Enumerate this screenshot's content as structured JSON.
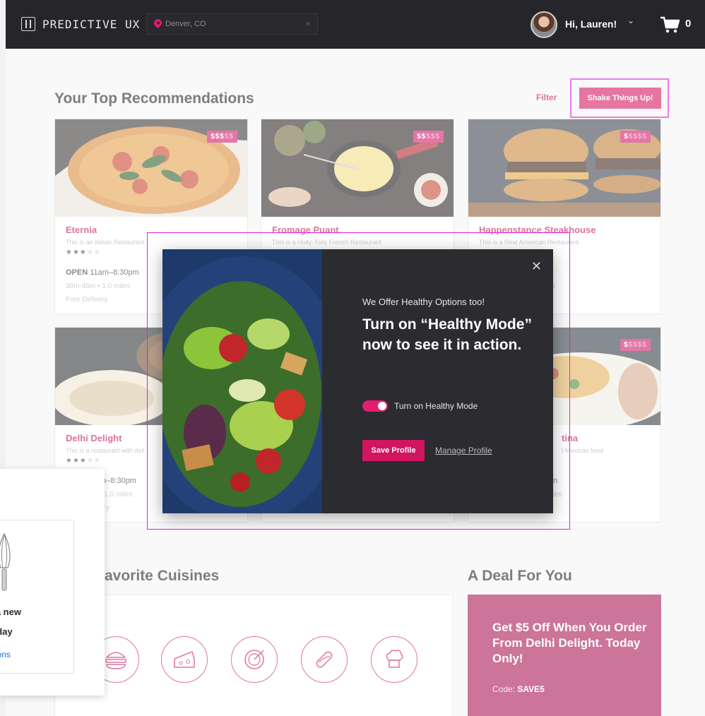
{
  "header": {
    "brand": "PREDICTIVE UX",
    "location_value": "Denver, CO",
    "clear_glyph": "×",
    "greeting": "Hi, Lauren!",
    "greeting_chevron": "⌄",
    "cart_count": "0"
  },
  "recommendations": {
    "title": "Your Top Recommendations",
    "filter_label": "Filter",
    "shake_label": "Shake Things Up!",
    "cards": [
      {
        "name": "Eternia",
        "desc": "This is an Italian Restaurant",
        "price_on": "$$$",
        "price_off": "$$",
        "stars_on": "★★★",
        "stars_off": "★★",
        "status": "OPEN",
        "hours": "11am–8:30pm",
        "eta": "30m-45m  •  1.0 miles",
        "delivery": "Free Delivery"
      },
      {
        "name": "Fromage Puant",
        "desc": "This is a Hoity-Toity French Restaurant",
        "price_on": "$$",
        "price_off": "$$$",
        "stars_on": "",
        "stars_off": "",
        "status": "",
        "hours": "",
        "eta": "",
        "delivery": ""
      },
      {
        "name": "Happenstance Steakhouse",
        "desc": "This is a Real American Restaurant",
        "price_on": "$",
        "price_off": "$$$$",
        "stars_on": "",
        "stars_off": "",
        "status": "",
        "hours": "n",
        "eta": "les",
        "delivery": ""
      },
      {
        "name": "Delhi Delight",
        "desc": "This is a restaurant with deli",
        "price_on": "",
        "price_off": "",
        "stars_on": "★★★",
        "stars_off": "★★",
        "status": "",
        "hours": "m–8:30pm",
        "eta": "•  1.0 miles",
        "delivery": "ery"
      },
      {
        "name": "tina",
        "desc": "t Mexican food",
        "price_on": "$",
        "price_off": "$$$$",
        "stars_on": "",
        "stars_off": "",
        "status": "",
        "hours": "n",
        "eta": "les",
        "delivery": ""
      }
    ]
  },
  "cuisines": {
    "title": "avorite Cuisines",
    "icons": [
      "burger-icon",
      "cheese-icon",
      "pizza-icon",
      "hotdog-icon",
      "chef-hat-icon"
    ]
  },
  "deal": {
    "title": "A Deal For You",
    "text": "Get $5 Off When You Order From Delhi Delight. Today Only!",
    "code_label": "Code:",
    "code": "SAVE5"
  },
  "side_panel": {
    "line1": "y a new",
    "line2": "today",
    "link": "ptions"
  },
  "modal": {
    "close_glyph": "✕",
    "kicker": "We Offer Healthy Options too!",
    "headline": "Turn on “Healthy Mode” now to see it in action.",
    "toggle_label": "Turn on Healthy Mode",
    "toggle_on": true,
    "save_label": "Save Profile",
    "manage_label": "Manage Profile"
  },
  "colors": {
    "accent": "#d3145f",
    "header_bg": "#25252a",
    "modal_bg": "#2b2b30",
    "deal_bg": "#a8124f",
    "highlight_outline": "#e81dd6"
  }
}
